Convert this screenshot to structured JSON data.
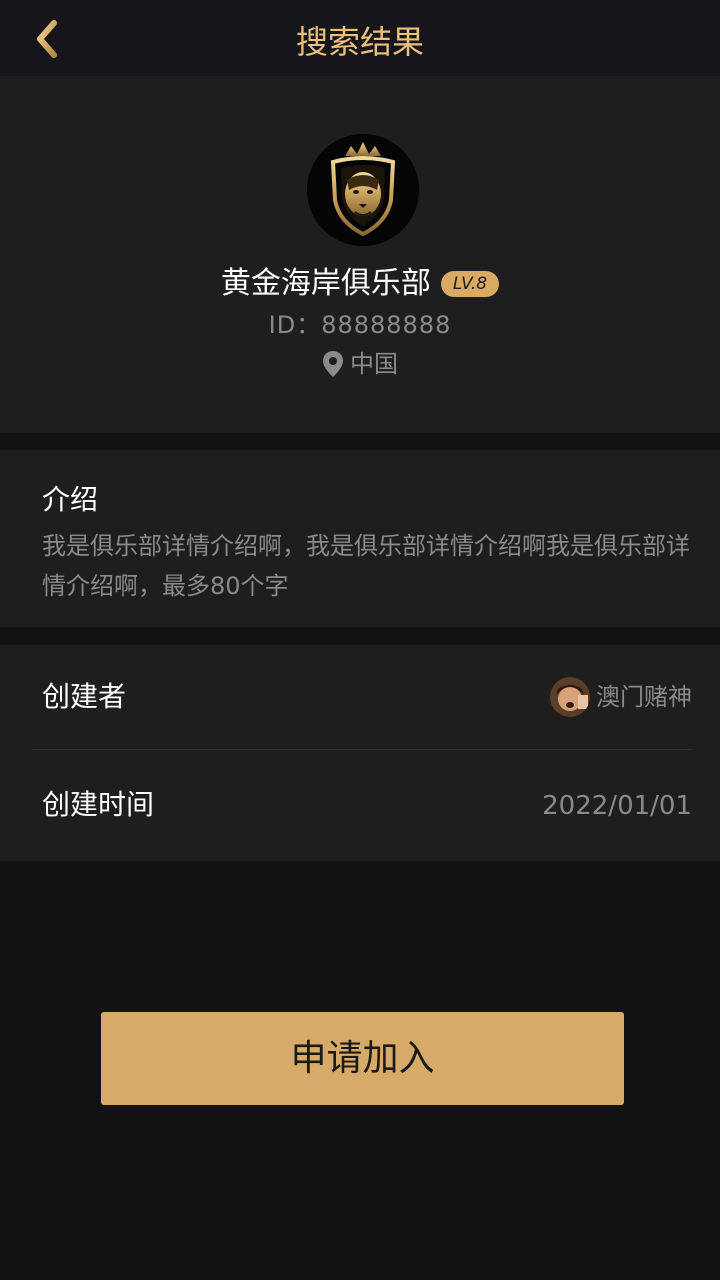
{
  "header": {
    "title": "搜索结果",
    "back_icon": "chevron-left-icon"
  },
  "club": {
    "name": "黄金海岸俱乐部",
    "level": "LV.8",
    "id": "ID：88888888",
    "location": "中国",
    "logo_icon": "lion-crest-logo"
  },
  "intro": {
    "title": "介绍",
    "body": "我是俱乐部详情介绍啊，我是俱乐部详情介绍啊我是俱乐部详情介绍啊，最多80个字"
  },
  "info": {
    "creator_label": "创建者",
    "creator_name": "澳门赌神",
    "created_label": "创建时间",
    "created_date": "2022/01/01"
  },
  "actions": {
    "apply_label": "申请加入"
  },
  "colors": {
    "accent": "#e9c07e",
    "button": "#d8aa6a",
    "background": "#121212",
    "card": "#1e1e1e"
  }
}
